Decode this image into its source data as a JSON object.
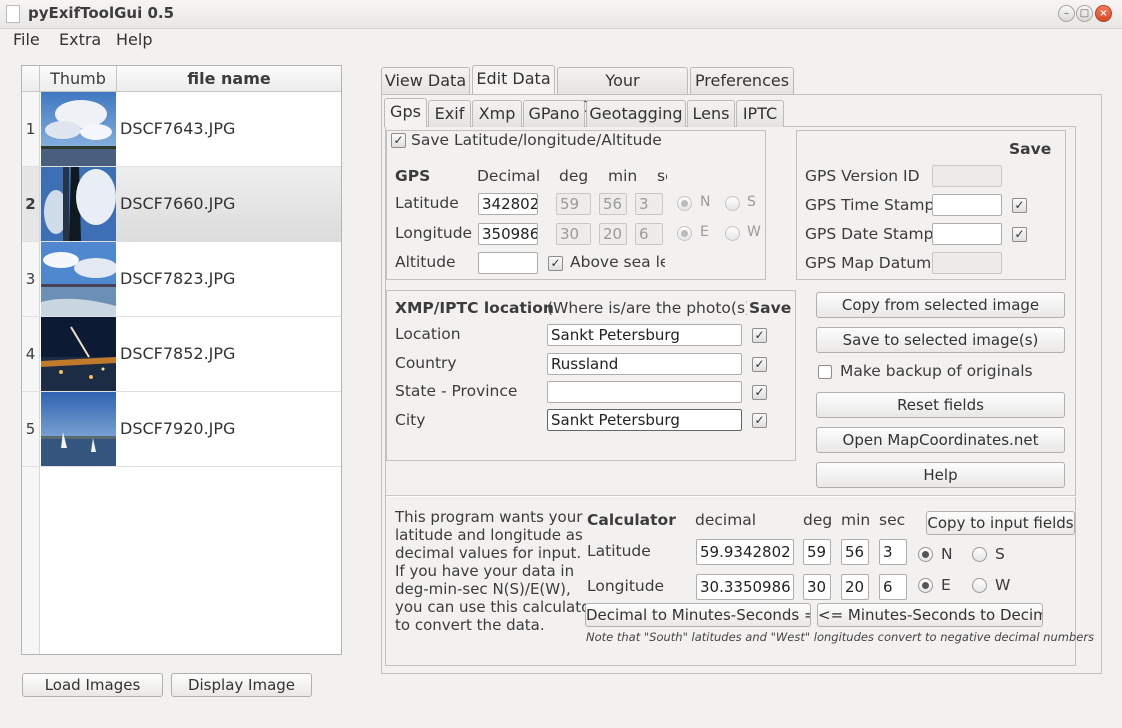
{
  "window": {
    "title": "pyExifToolGui 0.5",
    "controls": [
      "minimize",
      "maximize",
      "close"
    ]
  },
  "menubar": {
    "file": "File",
    "extra": "Extra",
    "help": "Help"
  },
  "imagelist": {
    "headers": {
      "thumb": "Thumb",
      "filename": "file name"
    },
    "rows": [
      {
        "num": "1",
        "file": "DSCF7643.JPG"
      },
      {
        "num": "2",
        "file": "DSCF7660.JPG"
      },
      {
        "num": "3",
        "file": "DSCF7823.JPG"
      },
      {
        "num": "4",
        "file": "DSCF7852.JPG"
      },
      {
        "num": "5",
        "file": "DSCF7920.JPG"
      }
    ],
    "selected_row": 2
  },
  "bottom_buttons": {
    "load": "Load Images",
    "display": "Display Image"
  },
  "main_tabs": [
    "View Data",
    "Edit Data",
    "Your Commands",
    "Preferences"
  ],
  "active_main_tab": "Edit Data",
  "sub_tabs": [
    "Gps",
    "Exif",
    "Xmp",
    "GPano",
    "Geotagging",
    "Lens",
    "IPTC"
  ],
  "active_sub_tab": "Gps",
  "gps": {
    "save_lla": "Save Latitude/longitude/Altitude",
    "heading": "GPS",
    "col_decimal": "Decimal",
    "col_deg": "deg",
    "col_min": "min",
    "col_sec": "se",
    "latitude_label": "Latitude",
    "latitude_decimal": "342802",
    "lat_deg": "59",
    "lat_min": "56",
    "lat_sec": "3",
    "lat_n": "N",
    "lat_s": "S",
    "longitude_label": "Longitude",
    "longitude_decimal": "350986",
    "lon_deg": "30",
    "lon_min": "20",
    "lon_sec": "6",
    "lon_e": "E",
    "lon_w": "W",
    "altitude_label": "Altitude",
    "altitude_value": "",
    "above_sea": "Above sea lev"
  },
  "gps_fields": {
    "save_header": "Save",
    "version_id": "GPS Version ID",
    "time_stamp": "GPS Time Stamp",
    "date_stamp": "GPS Date Stamp",
    "map_datum": "GPS Map Datum"
  },
  "xmp": {
    "heading": "XMP/IPTC location",
    "hint": "(Where is/are the photo(s) t",
    "save_header": "Save",
    "location_label": "Location",
    "location_value": "Sankt Petersburg",
    "country_label": "Country",
    "country_value": "Russland",
    "state_label": "State - Province",
    "state_value": "",
    "city_label": "City",
    "city_value": "Sankt Petersburg"
  },
  "actions": {
    "copy_from": "Copy from selected image",
    "save_to": "Save to selected image(s)",
    "make_backup": "Make backup of originals",
    "reset": "Reset fields",
    "open_map": "Open MapCoordinates.net",
    "help": "Help"
  },
  "calculator": {
    "description": [
      "This program wants your",
      "latitude and longitude as",
      "decimal values for input.",
      "If you have your data in",
      "deg-min-sec N(S)/E(W),",
      "you can use this calculator",
      "to convert the data."
    ],
    "heading": "Calculator",
    "col_decimal": "decimal",
    "col_deg": "deg",
    "col_min": "min",
    "col_sec": "sec",
    "copy_button": "Copy to input fields",
    "latitude_label": "Latitude",
    "latitude_decimal": "59.9342802",
    "lat_deg": "59",
    "lat_min": "56",
    "lat_sec": "3",
    "lat_n": "N",
    "lat_s": "S",
    "longitude_label": "Longitude",
    "longitude_decimal": "30.3350986",
    "lon_deg": "30",
    "lon_min": "20",
    "lon_sec": "6",
    "lon_e": "E",
    "lon_w": "W",
    "to_dms_button": "Decimal to Minutes-Seconds =>",
    "to_dec_button": "<= Minutes-Seconds to Decimal",
    "note": "Note that \"South\" latitudes and \"West\" longitudes convert to negative decimal numbers"
  }
}
